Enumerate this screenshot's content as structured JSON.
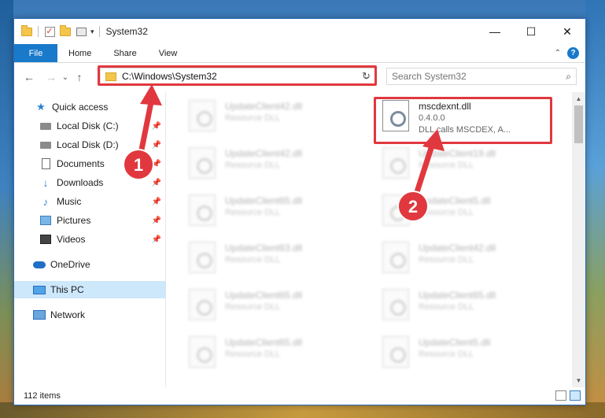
{
  "window": {
    "title": "System32",
    "controls": {
      "minimize": "—",
      "maximize": "☐",
      "close": "✕"
    }
  },
  "ribbon": {
    "tabs": [
      "File",
      "Home",
      "Share",
      "View"
    ],
    "collapse": "⌃",
    "help": "?"
  },
  "address_bar": {
    "path": "C:\\Windows\\System32",
    "dropdown": "⌄",
    "refresh": "↻"
  },
  "nav_buttons": {
    "back": "←",
    "forward": "→",
    "recent": "⌄",
    "up": "↑"
  },
  "search": {
    "placeholder": "Search System32",
    "icon": "search-icon"
  },
  "sidebar": {
    "items": [
      {
        "label": "Quick access",
        "icon": "star-icon",
        "pinned": false
      },
      {
        "label": "Local Disk (C:)",
        "icon": "disk-icon",
        "pinned": true
      },
      {
        "label": "Local Disk (D:)",
        "icon": "disk-icon",
        "pinned": true
      },
      {
        "label": "Documents",
        "icon": "document-icon",
        "pinned": true
      },
      {
        "label": "Downloads",
        "icon": "download-icon",
        "pinned": true
      },
      {
        "label": "Music",
        "icon": "music-icon",
        "pinned": true
      },
      {
        "label": "Pictures",
        "icon": "picture-icon",
        "pinned": true
      },
      {
        "label": "Videos",
        "icon": "video-icon",
        "pinned": true
      },
      {
        "label": "OneDrive",
        "icon": "cloud-icon",
        "pinned": false
      },
      {
        "label": "This PC",
        "icon": "computer-icon",
        "pinned": false,
        "selected": true
      },
      {
        "label": "Network",
        "icon": "network-icon",
        "pinned": false
      }
    ]
  },
  "files": [
    {
      "name": "UpdateClient42.dll",
      "desc": "Resource DLL",
      "blurred": true
    },
    {
      "name": "mscdexnt.dll",
      "version": "0.4.0.0",
      "desc": "DLL calls MSCDEX, A...",
      "blurred": false
    },
    {
      "name": "UpdateClient42.dll",
      "desc": "Resource DLL",
      "blurred": true
    },
    {
      "name": "UpdateClient19.dll",
      "desc": "Resource DLL",
      "blurred": true
    },
    {
      "name": "UpdateClient65.dll",
      "desc": "Resource DLL",
      "blurred": true
    },
    {
      "name": "UpdateClient5.dll",
      "desc": "Resource DLL",
      "blurred": true
    },
    {
      "name": "UpdateClient63.dll",
      "desc": "Resource DLL",
      "blurred": true
    },
    {
      "name": "UpdateClient42.dll",
      "desc": "Resource DLL",
      "blurred": true
    },
    {
      "name": "UpdateClient65.dll",
      "desc": "Resource DLL",
      "blurred": true
    },
    {
      "name": "UpdateClient65.dll",
      "desc": "Resource DLL",
      "blurred": true
    },
    {
      "name": "UpdateClient65.dll",
      "desc": "Resource DLL",
      "blurred": true
    },
    {
      "name": "UpdateClient5.dll",
      "desc": "Resource DLL",
      "blurred": true
    }
  ],
  "status": {
    "count": "112 items"
  },
  "annotations": {
    "step1": "1",
    "step2": "2",
    "color": "#e0383e"
  },
  "colors": {
    "accent": "#1979ca",
    "selection": "#cde8fa"
  }
}
